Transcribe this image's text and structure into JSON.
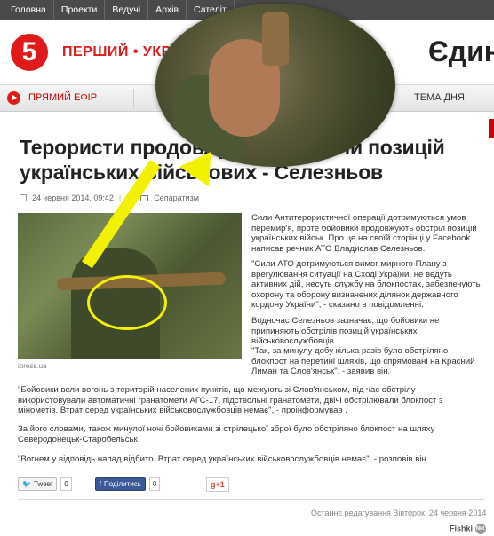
{
  "topnav": [
    "Головна",
    "Проекти",
    "Ведучі",
    "Архів",
    "Сателіт"
  ],
  "header": {
    "logo_text": "5",
    "channel": "ПЕРШИЙ • УКР",
    "right_title": "Єдина"
  },
  "menubar": {
    "live_label": "ПРЯМИЙ ЕФІР",
    "topic_label": "ТЕМА ДНЯ"
  },
  "article": {
    "headline": "Терористи продовжують обстріли позицій українських військових - Селезньов",
    "date": "24 червня 2014, 09:42",
    "category": "Сепаратизм",
    "photo_credit": "ipress.ua",
    "col_paragraphs": [
      "Сили Антитерористичної операції дотримуються умов перемир'я, проте бойовики продовжують обстріл позицій українських військ. Про це на своїй сторінці у Facebook написав речник АТО Владислав Селезньов.",
      "\"Сили АТО дотримуються вимог мирного Плану з врегулювання ситуації на Сході України, не ведуть активних дій, несуть службу на блокпостах, забезпечують охорону та оборону визначених ділянок державного кордону України\", - сказано в повідомленні.",
      "Водночас Селезньов зазначає, що бойовики не припиняють обстрілів позицій українських військовослужбовців.",
      "\"Так, за минулу добу кілька разів було обстріляно блокпост на перетині шляхів, що спрямовані на Красний Лиман та Слов'янськ\", - заявив він."
    ],
    "full_paragraphs": [
      "\"Бойовики вели вогонь з територій населених пунктів, що межують зі Слов'янськом, під час обстрілу використовували автоматичні гранатомети АГС-17, підствольні гранатомети, двічі обстрілювали блокпост з мінометів. Втрат серед українських військовослужбовців немає\", - проінформував .",
      "За його словами, також минулої ночі бойовиками зі стрілецької зброї було обстріляно блокпост на шляху Северодонецьк-Старобельськ.",
      "\"Вогнем у відповідь напад відбито. Втрат серед українських військовослужбовців немає\", - розповів він."
    ],
    "edited": "Останнє редагування Вівторок, 24 червня 2014"
  },
  "social": {
    "tweet_label": "Tweet",
    "tweet_count": "0",
    "fb_label": "Поділитись",
    "fb_count": "0",
    "gplus_label": "g+1"
  },
  "watermark": {
    "text": "Fishki",
    "badge": "Net"
  }
}
